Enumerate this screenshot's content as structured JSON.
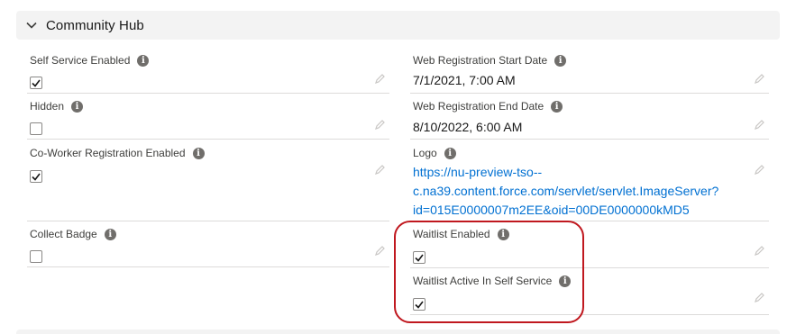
{
  "section": {
    "title": "Community Hub",
    "toggle_icon": "chevron-down-icon"
  },
  "left_fields": [
    {
      "label": "Self Service Enabled",
      "type": "checkbox",
      "checked": true
    },
    {
      "label": "Hidden",
      "type": "checkbox",
      "checked": false
    },
    {
      "label": "Co-Worker Registration Enabled",
      "type": "checkbox",
      "checked": true
    },
    {
      "label": "Collect Badge",
      "type": "checkbox",
      "checked": false
    }
  ],
  "right_fields": [
    {
      "label": "Web Registration Start Date",
      "type": "text",
      "value": "7/1/2021, 7:00 AM"
    },
    {
      "label": "Web Registration End Date",
      "type": "text",
      "value": "8/10/2022, 6:00 AM"
    },
    {
      "label": "Logo",
      "type": "link",
      "value": "https://nu-preview-tso--c.na39.content.force.com/servlet/servlet.ImageServer?id=015E0000007m2EE&oid=00DE0000000kMD5"
    },
    {
      "label": "Waitlist Enabled",
      "type": "checkbox",
      "checked": true
    },
    {
      "label": "Waitlist Active In Self Service",
      "type": "checkbox",
      "checked": true
    }
  ],
  "logo_link_lines": [
    "https://nu-preview-tso--",
    "c.na39.content.force.com/servlet/servlet.ImageServer?",
    "id=015E0000007m2EE&oid=00DE0000000kMD5"
  ],
  "icons": {
    "info": "i",
    "edit": "pencil-icon",
    "check": "checkmark-icon"
  },
  "colors": {
    "header_bg": "#f3f3f3",
    "link": "#0070d2",
    "highlight": "#c0181f",
    "divider": "#dddbda"
  }
}
